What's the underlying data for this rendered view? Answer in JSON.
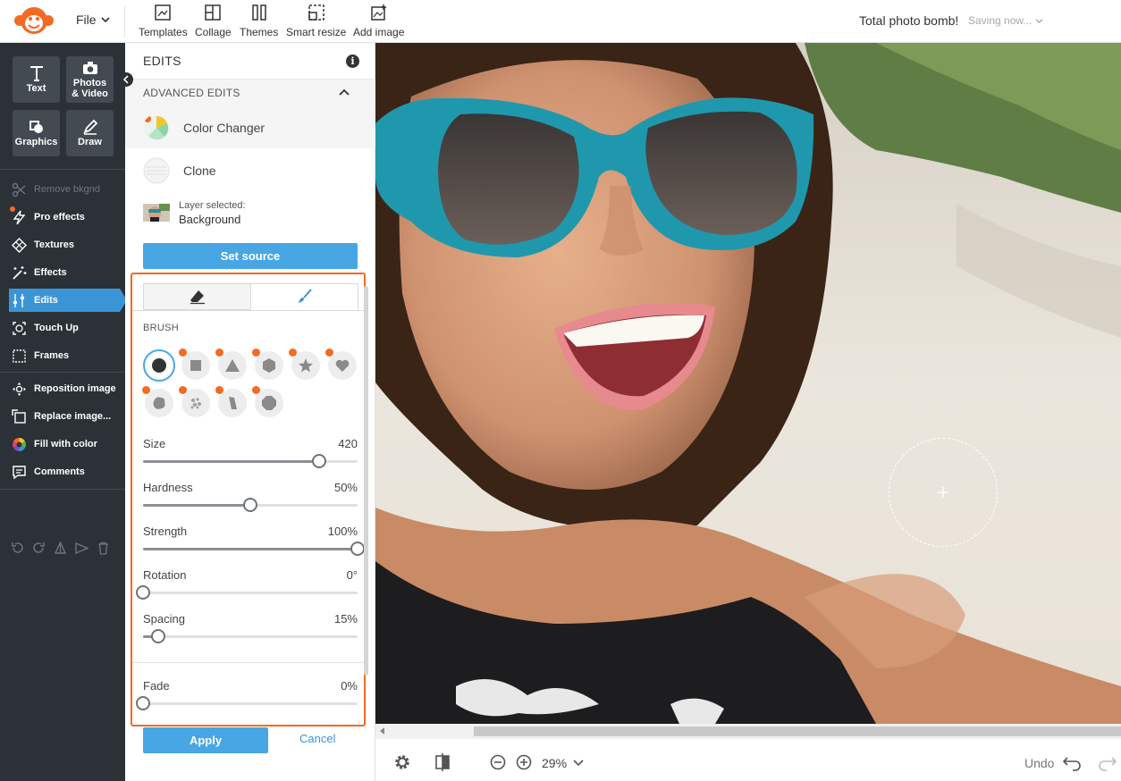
{
  "header": {
    "file_menu": "File",
    "tools": [
      {
        "label": "Templates",
        "icon": "templates-icon"
      },
      {
        "label": "Collage",
        "icon": "collage-icon"
      },
      {
        "label": "Themes",
        "icon": "themes-icon"
      },
      {
        "label": "Smart resize",
        "icon": "smart-resize-icon"
      },
      {
        "label": "Add image",
        "icon": "add-image-icon"
      }
    ],
    "doc_title": "Total photo bomb!",
    "save_status": "Saving now..."
  },
  "sidebar": {
    "tiles": [
      {
        "label": "Text",
        "icon": "text-icon"
      },
      {
        "label": "Photos & Video",
        "icon": "camera-icon"
      },
      {
        "label": "Graphics",
        "icon": "graphics-icon"
      },
      {
        "label": "Draw",
        "icon": "draw-icon"
      }
    ],
    "items": [
      {
        "label": "Remove bkgnd",
        "icon": "scissors-icon",
        "state": "disabled"
      },
      {
        "label": "Pro effects",
        "icon": "lightning-icon",
        "state": "pro"
      },
      {
        "label": "Textures",
        "icon": "textures-icon",
        "state": "normal"
      },
      {
        "label": "Effects",
        "icon": "magic-wand-icon",
        "state": "normal"
      },
      {
        "label": "Edits",
        "icon": "sliders-icon",
        "state": "active"
      },
      {
        "label": "Touch Up",
        "icon": "face-icon",
        "state": "normal"
      },
      {
        "label": "Frames",
        "icon": "frame-icon",
        "state": "normal"
      },
      {
        "label": "Reposition image",
        "icon": "reposition-icon",
        "state": "normal"
      },
      {
        "label": "Replace image...",
        "icon": "replace-icon",
        "state": "normal"
      },
      {
        "label": "Fill with color",
        "icon": "color-wheel-icon",
        "state": "normal"
      },
      {
        "label": "Comments",
        "icon": "comment-icon",
        "state": "normal"
      }
    ]
  },
  "panel": {
    "title": "EDITS",
    "advanced_title": "ADVANCED EDITS",
    "color_changer": "Color Changer",
    "clone": "Clone",
    "layer_caption": "Layer selected:",
    "layer_name": "Background",
    "set_source": "Set source",
    "brush_label": "BRUSH",
    "sliders": [
      {
        "label": "Size",
        "display": "420",
        "fraction": 0.82
      },
      {
        "label": "Hardness",
        "display": "50%",
        "fraction": 0.5
      },
      {
        "label": "Strength",
        "display": "100%",
        "fraction": 1.0
      },
      {
        "label": "Rotation",
        "display": "0°",
        "fraction": 0.0
      },
      {
        "label": "Spacing",
        "display": "15%",
        "fraction": 0.07
      }
    ],
    "fade": {
      "label": "Fade",
      "display": "0%",
      "fraction": 0.0
    },
    "apply": "Apply",
    "cancel": "Cancel"
  },
  "bottom": {
    "zoom": "29%",
    "undo": "Undo"
  },
  "colors": {
    "accent": "#49a6e5",
    "pro": "#f36a24",
    "sidebar_bg": "#2c3137"
  }
}
